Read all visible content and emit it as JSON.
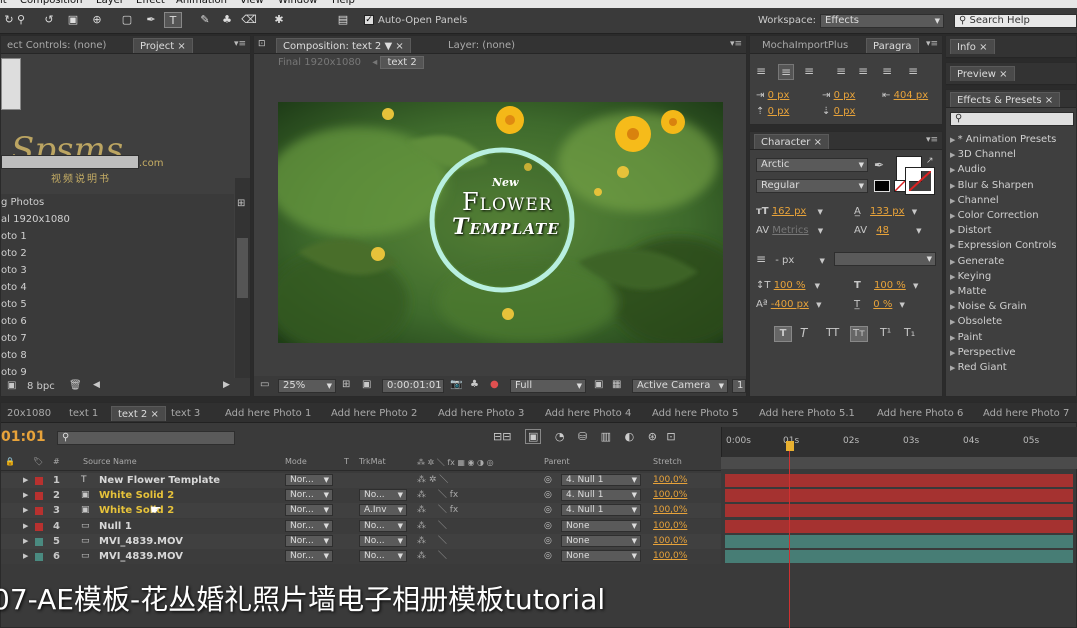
{
  "menubar": {
    "items": [
      "it",
      "Composition",
      "Layer",
      "Effect",
      "Animation",
      "View",
      "Window",
      "Help"
    ]
  },
  "toolbar": {
    "auto_open_label": "Auto-Open Panels",
    "workspace_label": "Workspace:",
    "workspace_value": "Effects",
    "search_placeholder": "Search Help"
  },
  "project_panel": {
    "tab_effect_controls": "ect Controls: (none)",
    "tab_project": "Project",
    "items": [
      "g Photos",
      "al 1920x1080",
      "oto 1",
      "oto 2",
      "oto 3",
      "oto 4",
      "oto 5",
      "oto 6",
      "oto 7",
      "oto 8",
      "oto 9"
    ],
    "bpc": "8 bpc",
    "watermark_main": "Spsms",
    "watermark_com": ".com",
    "watermark_sub": "视频说明书"
  },
  "composition_panel": {
    "tab_label": "Composition: text 2",
    "layer_tab": "Layer: (none)",
    "breadcrumb_final": "Final 1920x1080",
    "breadcrumb_text2": "text 2",
    "title_new": "New",
    "title_flower": "Flower",
    "title_template": "Template",
    "zoom": "25%",
    "timecode": "0:00:01:01",
    "resolution": "Full",
    "camera": "Active Camera",
    "views": "1"
  },
  "paragraph_panel": {
    "tab_mocha": "MochaImportPlus",
    "tab_paragraph": "Paragra",
    "indent_left": "0 px",
    "indent_first": "0 px",
    "indent_right": "404 px",
    "space_before": "0 px",
    "space_after": "0 px"
  },
  "character_panel": {
    "tab": "Character",
    "font": "Arctic",
    "style": "Regular",
    "size": "162 px",
    "leading": "133 px",
    "kerning": "Metrics",
    "tracking": "48",
    "stroke": "- px",
    "vscale": "100 %",
    "hscale": "100 %",
    "baseline": "-400 px",
    "tsume": "0 %"
  },
  "info_panel": {
    "tab": "Info"
  },
  "preview_panel": {
    "tab": "Preview"
  },
  "effects_panel": {
    "tab": "Effects & Presets",
    "items": [
      "* Animation Presets",
      "3D Channel",
      "Audio",
      "Blur & Sharpen",
      "Channel",
      "Color Correction",
      "Distort",
      "Expression Controls",
      "Generate",
      "Keying",
      "Matte",
      "Noise & Grain",
      "Obsolete",
      "Paint",
      "Perspective",
      "Red Giant"
    ]
  },
  "timeline": {
    "tabs": [
      "20x1080",
      "text 1",
      "text 2",
      "text 3",
      "Add here Photo 1",
      "Add here Photo 2",
      "Add here Photo 3",
      "Add here Photo 4",
      "Add here Photo 5",
      "Add here  Photo 5.1",
      "Add here Photo 6",
      "Add here Photo 7"
    ],
    "timecode": "01:01",
    "headers": {
      "num": "#",
      "source": "Source Name",
      "mode": "Mode",
      "t": "T",
      "trkmat": "TrkMat",
      "parent": "Parent",
      "stretch": "Stretch"
    },
    "ruler": [
      "0:00s",
      "01s",
      "02s",
      "03s",
      "04s",
      "05s"
    ],
    "layers": [
      {
        "num": "1",
        "name": "New  Flower  Template",
        "mode": "Nor...",
        "trkmat": "",
        "parent": "4. Null 1",
        "stretch": "100,0%",
        "color": "#b8312f"
      },
      {
        "num": "2",
        "name": "White Solid 2",
        "mode": "Nor...",
        "trkmat": "No...",
        "parent": "4. Null 1",
        "stretch": "100,0%",
        "color": "#b8312f"
      },
      {
        "num": "3",
        "name": "White Solid 2",
        "mode": "Nor...",
        "trkmat": "A.Inv",
        "parent": "4. Null 1",
        "stretch": "100,0%",
        "color": "#b8312f"
      },
      {
        "num": "4",
        "name": "Null 1",
        "mode": "Nor...",
        "trkmat": "No...",
        "parent": "None",
        "stretch": "100,0%",
        "color": "#b8312f"
      },
      {
        "num": "5",
        "name": "MVI_4839.MOV",
        "mode": "Nor...",
        "trkmat": "No...",
        "parent": "None",
        "stretch": "100,0%",
        "color": "#4a8a80"
      },
      {
        "num": "6",
        "name": "MVI_4839.MOV",
        "mode": "Nor...",
        "trkmat": "No...",
        "parent": "None",
        "stretch": "100,0%",
        "color": "#4a8a80"
      }
    ]
  },
  "subtitle": "07-AE模板-花丛婚礼照片墙电子相册模板tutorial"
}
